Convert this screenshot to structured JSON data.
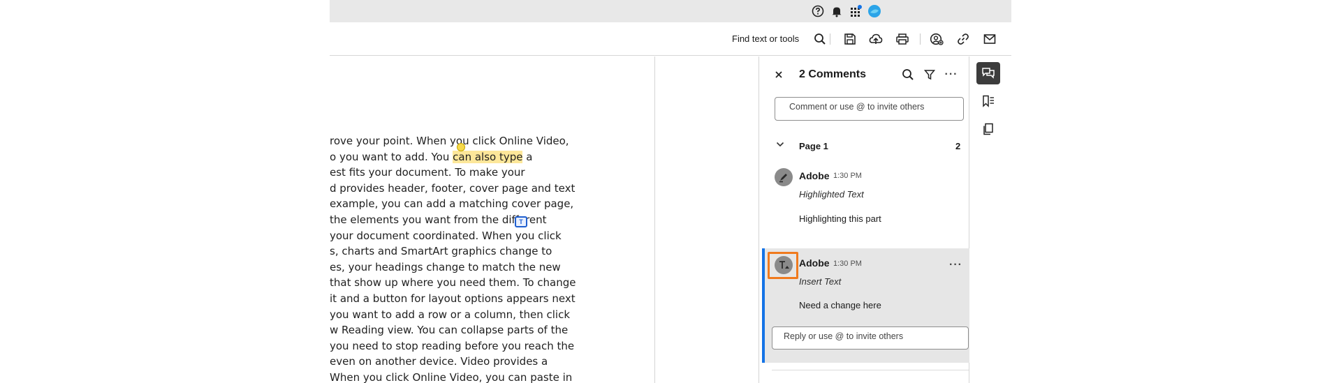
{
  "topbar": {
    "icons": [
      "help-icon",
      "notification-bell-icon",
      "apps-grid-icon",
      "profile-avatar-icon"
    ],
    "colors": {
      "background": "#e8e8e8",
      "notification_dot": "#1473e6",
      "avatar": "#2ba4e8"
    }
  },
  "toolbar": {
    "find_label": "Find text or tools",
    "icons": [
      "search-icon",
      "save-icon",
      "upload-cloud-icon",
      "print-icon",
      "share-user-icon",
      "link-icon",
      "mail-icon"
    ]
  },
  "document": {
    "lines": [
      {
        "before": "rove your point. When you click Online Video,",
        "highlight": "",
        "after": ""
      },
      {
        "before": "o you want to add. You ",
        "highlight": "can also type",
        "after": " a"
      },
      {
        "before": "est fits your document. To make your",
        "highlight": "",
        "after": ""
      },
      {
        "before": "d provides header, footer, cover page and text",
        "highlight": "",
        "after": ""
      },
      {
        "before": " example, you can add a matching cover page,",
        "highlight": "",
        "after": ""
      },
      {
        "before": " the elements you want from the different",
        "highlight": "",
        "after": ""
      },
      {
        "before": " your document coordinated. When you click",
        "highlight": "",
        "after": ""
      },
      {
        "before": "s, charts and SmartArt graphics change to",
        "highlight": "",
        "after": ""
      },
      {
        "before": "es, your headings change to match the new",
        "highlight": "",
        "after": ""
      },
      {
        "before": "that show up where you need them. To change",
        "highlight": "",
        "after": ""
      },
      {
        "before": " it and a button for layout options appears next",
        "highlight": "",
        "after": ""
      },
      {
        "before": "you want to add a row or a column, then click",
        "highlight": "",
        "after": ""
      },
      {
        "before": "w Reading view. You can collapse parts of the",
        "highlight": "",
        "after": ""
      },
      {
        "before": "you need to stop reading before you reach the",
        "highlight": "",
        "after": ""
      },
      {
        "before": "even on another device. Video provides a",
        "highlight": "",
        "after": ""
      },
      {
        "before": "When you click Online Video, you can paste in",
        "highlight": "",
        "after": ""
      }
    ],
    "highlight_color": "#fde79a"
  },
  "comments_panel": {
    "title": "2 Comments",
    "comment_placeholder": "Comment or use @ to invite others",
    "page_label": "Page 1",
    "page_count": "2",
    "comments": [
      {
        "author": "Adobe",
        "time": "1:30 PM",
        "kind": "Highlighted Text",
        "body": "Highlighting this part",
        "icon": "highlighter-icon"
      },
      {
        "author": "Adobe",
        "time": "1:30 PM",
        "kind": "Insert Text",
        "body": "Need a change here",
        "icon": "insert-text-icon"
      }
    ],
    "reply_placeholder": "Reply or use @ to invite others",
    "accent": "#1473e6",
    "focus_color": "#f07a1e"
  },
  "rail": {
    "icons": [
      "comments-icon",
      "bookmarks-icon",
      "pages-icon"
    ]
  }
}
